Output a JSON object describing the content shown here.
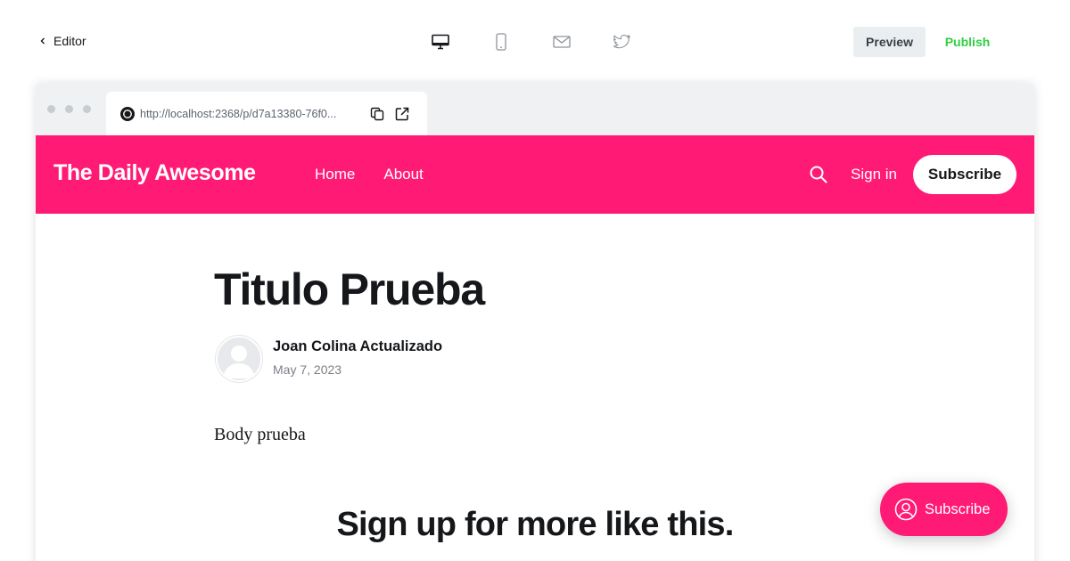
{
  "topbar": {
    "back_label": "Editor",
    "devices": [
      "desktop-icon",
      "mobile-icon",
      "email-icon",
      "twitter-icon"
    ],
    "preview_label": "Preview",
    "publish_label": "Publish",
    "publish_color": "#30cf43"
  },
  "browser": {
    "url": "http://localhost:2368/p/d7a13380-76f0..."
  },
  "site": {
    "title": "The Daily Awesome",
    "accent_color": "#ff1a75",
    "nav": [
      "Home",
      "About"
    ],
    "signin_label": "Sign in",
    "subscribe_label": "Subscribe"
  },
  "post": {
    "title": "Titulo Prueba",
    "author": "Joan Colina Actualizado",
    "date": "May 7, 2023",
    "body": "Body prueba",
    "cta_title": "Sign up for more like this."
  },
  "portal": {
    "label": "Subscribe"
  }
}
